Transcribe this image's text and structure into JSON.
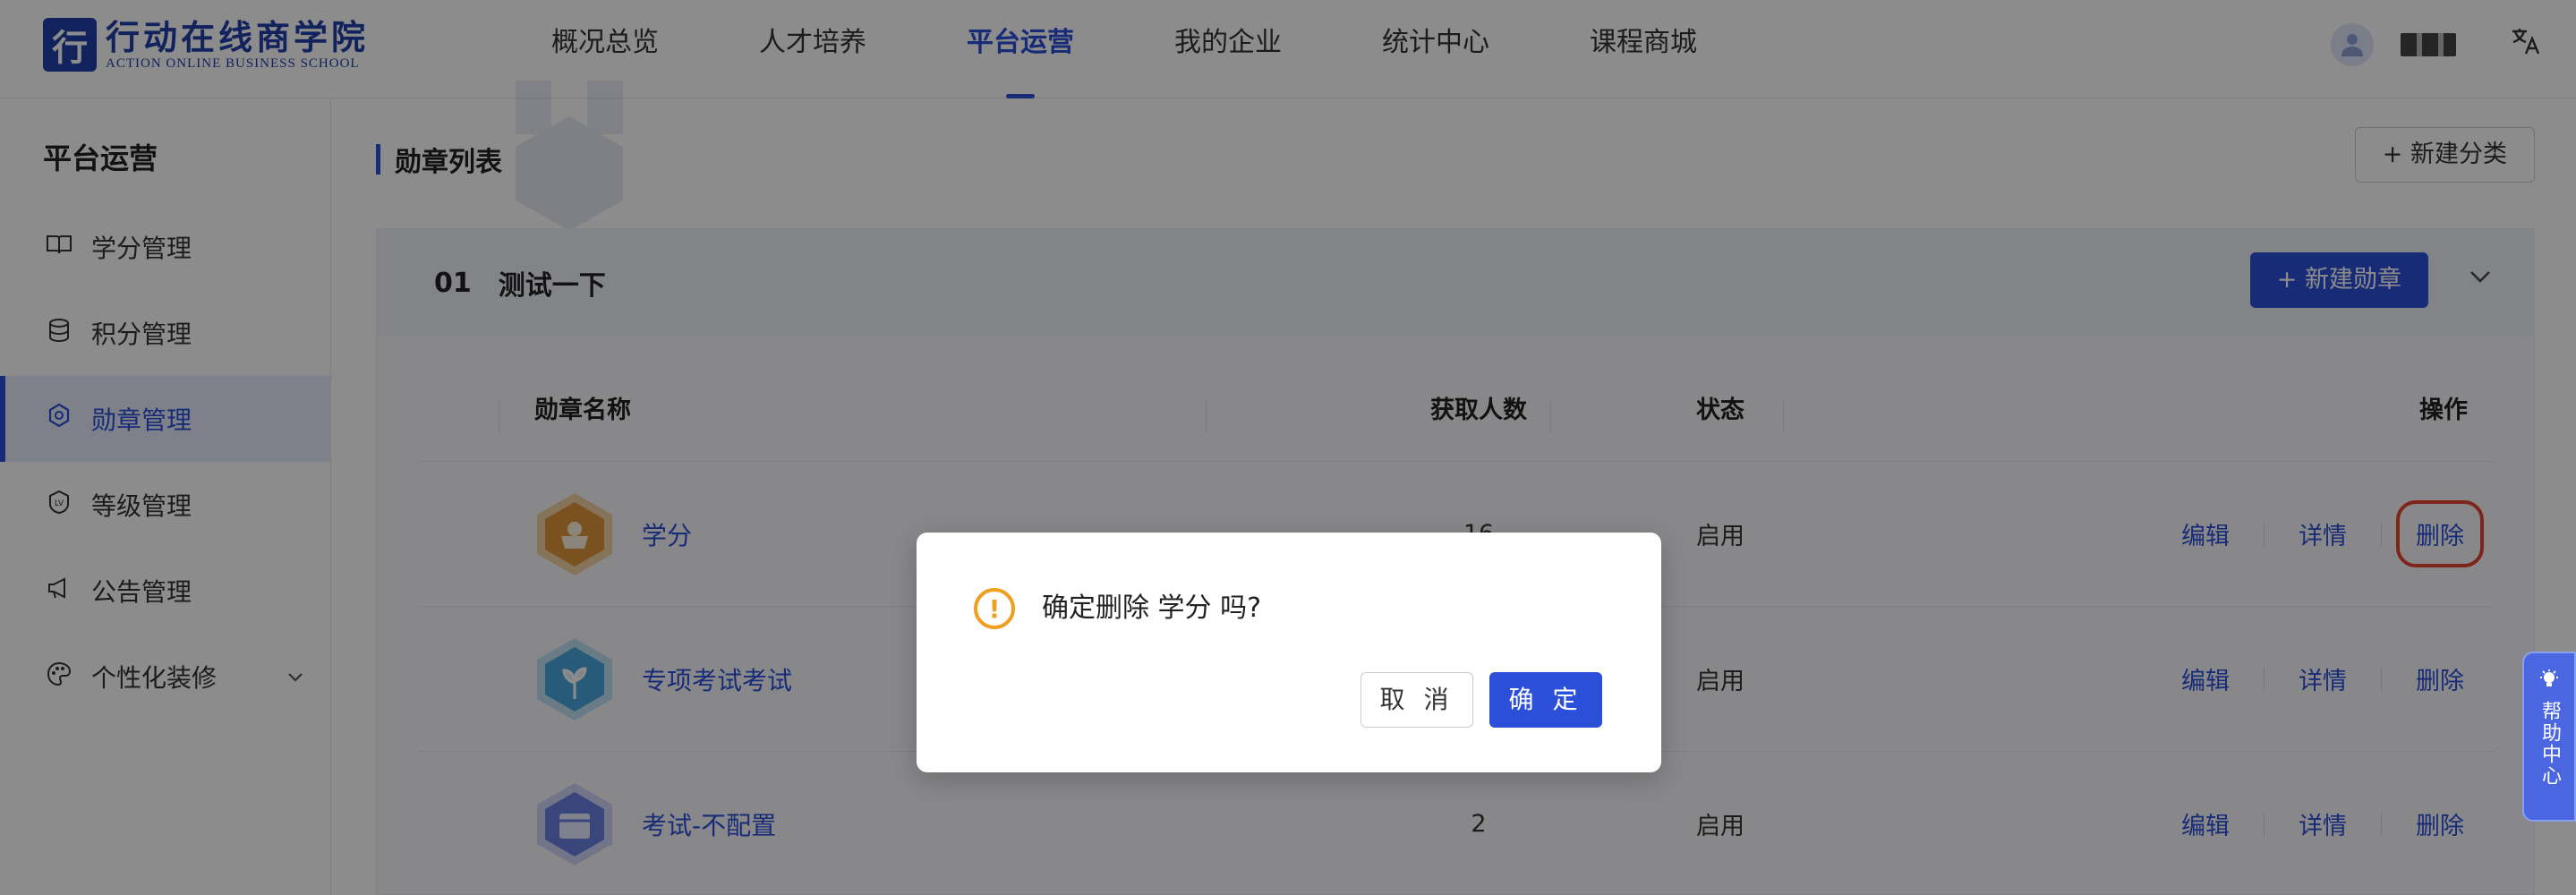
{
  "header": {
    "logo_cn": "行动在线商学院",
    "logo_en": "ACTION ONLINE BUSINESS SCHOOL",
    "nav": [
      {
        "label": "概况总览"
      },
      {
        "label": "人才培养"
      },
      {
        "label": "平台运营"
      },
      {
        "label": "我的企业"
      },
      {
        "label": "统计中心"
      },
      {
        "label": "课程商城"
      }
    ],
    "active_nav": "平台运营",
    "lang_icon": "translate-icon"
  },
  "sidebar": {
    "title": "平台运营",
    "items": [
      {
        "label": "学分管理",
        "icon": "book-icon"
      },
      {
        "label": "积分管理",
        "icon": "coins-icon"
      },
      {
        "label": "勋章管理",
        "icon": "medal-icon"
      },
      {
        "label": "等级管理",
        "icon": "level-icon"
      },
      {
        "label": "公告管理",
        "icon": "megaphone-icon"
      },
      {
        "label": "个性化装修",
        "icon": "palette-icon"
      }
    ],
    "active": "勋章管理"
  },
  "main": {
    "title": "勋章列表",
    "new_category_button": "+ 新建分类",
    "group": {
      "number": "01",
      "name": "测试一下",
      "new_badge_button": "+ 新建勋章"
    },
    "table": {
      "headers": {
        "name": "勋章名称",
        "count": "获取人数",
        "status": "状态",
        "ops": "操作"
      },
      "rows": [
        {
          "name": "学分",
          "count": "16",
          "status": "启用",
          "color": "#e0953a"
        },
        {
          "name": "专项考试考试",
          "count": "",
          "status": "启用",
          "color": "#4aa6dc"
        },
        {
          "name": "考试-不配置",
          "count": "2",
          "status": "启用",
          "color": "#6b7fe0"
        }
      ],
      "op_edit": "编辑",
      "op_detail": "详情",
      "op_delete": "删除"
    }
  },
  "modal": {
    "message": "确定删除 学分 吗?",
    "cancel": "取 消",
    "ok": "确 定"
  },
  "help": {
    "label": "帮助中心"
  },
  "colors": {
    "primary": "#2b4fd8",
    "warning": "#f0a020",
    "highlight": "#e8432e"
  }
}
